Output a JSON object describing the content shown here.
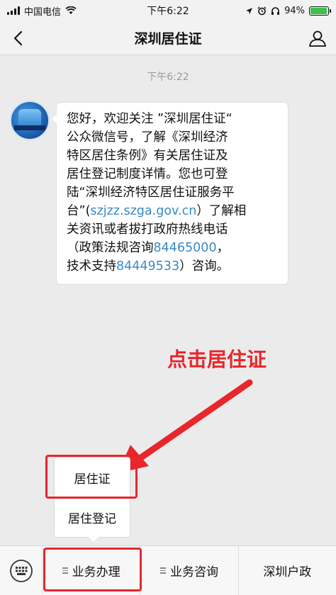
{
  "status_bar": {
    "carrier": "中国电信",
    "time": "下午6:22",
    "battery": "94%",
    "battery_level": 0.94
  },
  "nav": {
    "title": "深圳居住证",
    "back_icon": "chevron-left-icon",
    "profile_icon": "person-icon"
  },
  "chat": {
    "timestamp": "下午6:22",
    "message_lines": [
      [
        "您好，欢迎关注 ”深圳居住证“"
      ],
      [
        "公众微信号，了解《深圳经济"
      ],
      [
        "特区居住条例》有关居住证及"
      ],
      [
        "居住登记制度详情。您也可登"
      ],
      [
        "陆“深圳经济特区居住证服务平"
      ],
      [
        "台”(",
        "szjzz.szga.gov.cn",
        "）了解相"
      ],
      [
        "关资讯或者拔打政府热线电话"
      ],
      [
        "（政策法规咨询",
        "84465000",
        "，"
      ],
      [
        "技术支持",
        "84449533",
        "）咨询。"
      ]
    ],
    "link_color": "#3b8ac4"
  },
  "annotation": {
    "label": "点击居住证",
    "color": "#e8262b"
  },
  "submenu": {
    "items": [
      "居住证",
      "居住登记"
    ]
  },
  "bottom_menu": {
    "keyboard_icon": "keyboard-icon",
    "tabs": [
      "业务办理",
      "业务咨询",
      "深圳户政"
    ]
  }
}
